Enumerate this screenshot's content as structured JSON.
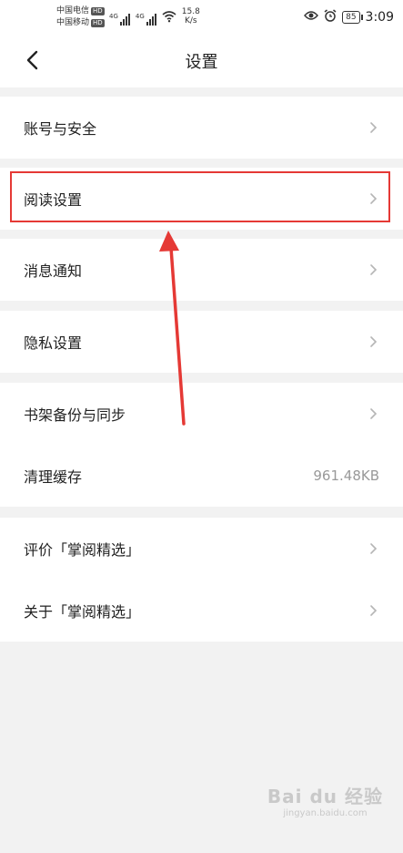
{
  "status_bar": {
    "carrier1": "中国电信",
    "carrier2": "中国移动",
    "hd": "HD",
    "net1": "4G",
    "net2": "4G",
    "speed_value": "15.8",
    "speed_unit": "K/s",
    "battery": "85",
    "time": "3:09"
  },
  "header": {
    "title": "设置"
  },
  "groups": [
    {
      "items": [
        {
          "label": "账号与安全"
        }
      ]
    },
    {
      "items": [
        {
          "label": "阅读设置"
        }
      ]
    },
    {
      "items": [
        {
          "label": "消息通知"
        }
      ]
    },
    {
      "items": [
        {
          "label": "隐私设置"
        }
      ]
    },
    {
      "items": [
        {
          "label": "书架备份与同步"
        },
        {
          "label": "清理缓存",
          "value": "961.48KB"
        }
      ]
    },
    {
      "items": [
        {
          "label": "评价「掌阅精选」"
        },
        {
          "label": "关于「掌阅精选」"
        }
      ]
    }
  ],
  "annotation": {
    "highlight_color": "#e53935"
  },
  "watermark": {
    "main": "Bai du 经验",
    "sub": "jingyan.baidu.com"
  }
}
